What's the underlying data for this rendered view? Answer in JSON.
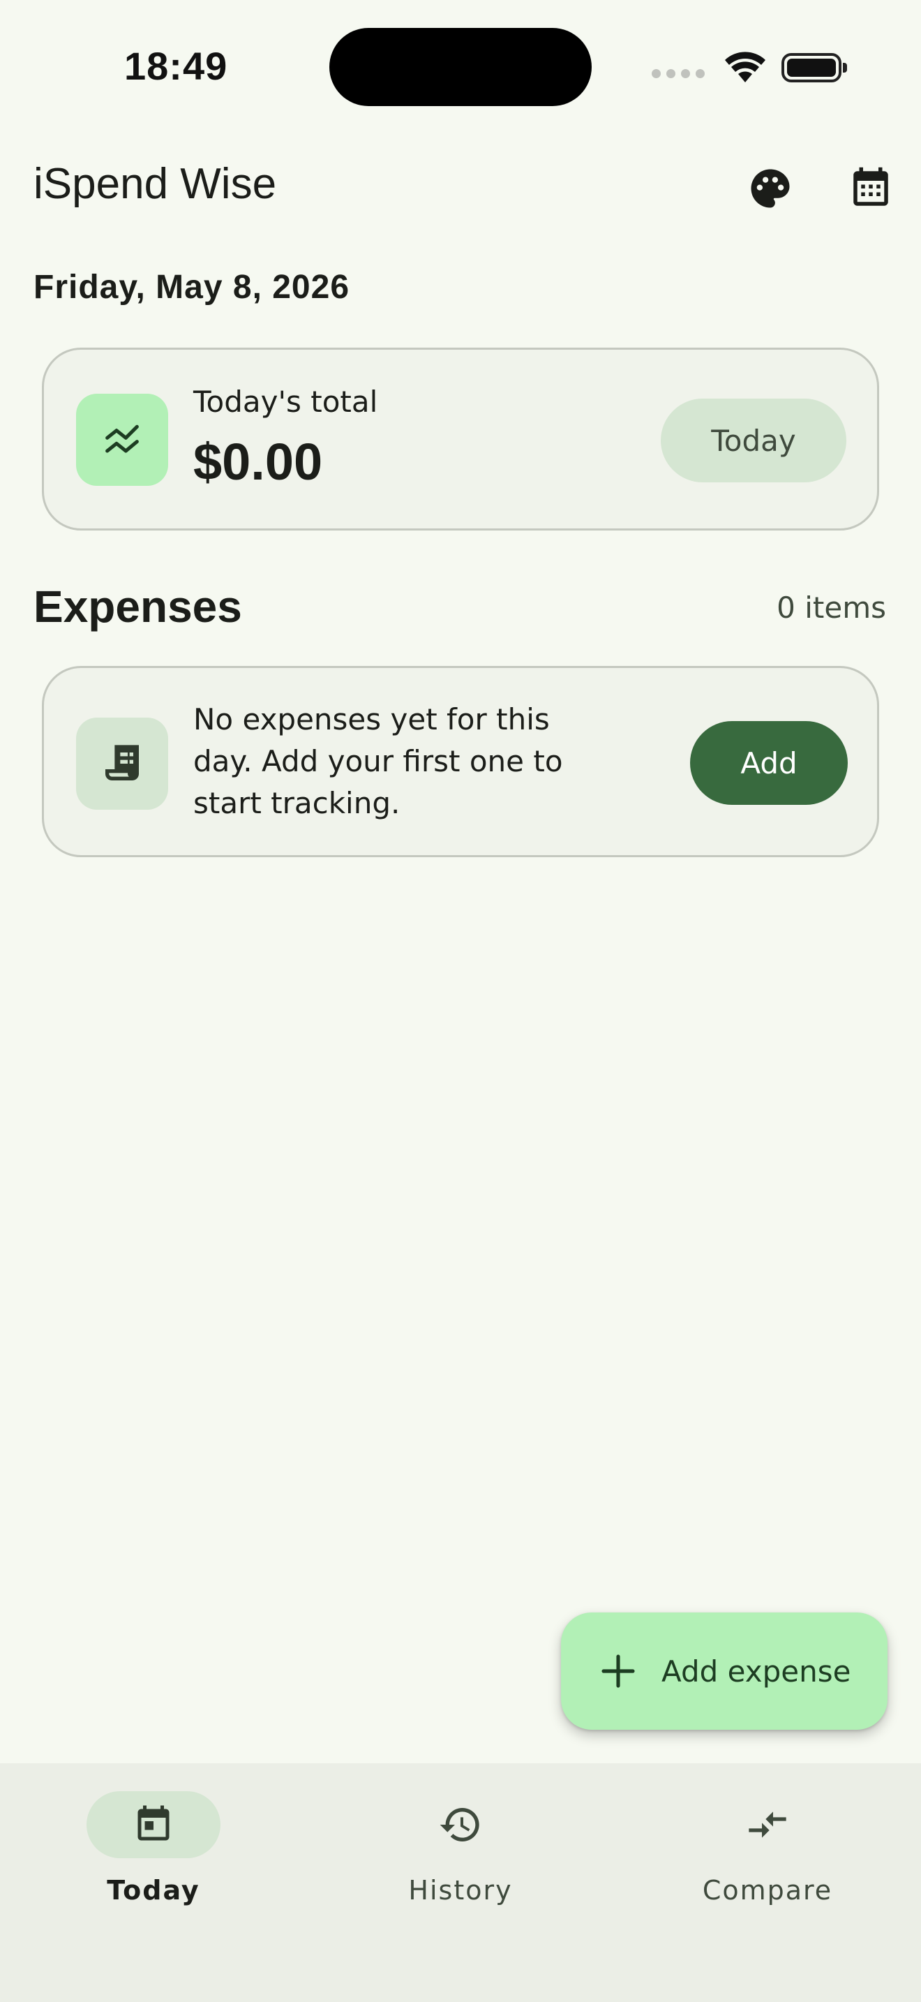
{
  "status_bar": {
    "time": "18:49",
    "icons": [
      "cellular-signal-icon",
      "wifi-icon",
      "battery-icon"
    ]
  },
  "app_bar": {
    "title": "iSpend Wise",
    "actions": [
      {
        "icon": "palette-icon"
      },
      {
        "icon": "calendar-icon"
      }
    ]
  },
  "date": "Friday, May 8, 2026",
  "summary": {
    "icon": "trend-icon",
    "label": "Today's total",
    "amount": "$0.00",
    "chip_label": "Today"
  },
  "expenses": {
    "title": "Expenses",
    "count": "0 items",
    "empty": {
      "icon": "receipt-icon",
      "message": "No expenses yet for this day. Add your first one to start tracking.",
      "button_label": "Add"
    }
  },
  "fab": {
    "icon": "plus-icon",
    "label": "Add expense"
  },
  "bottom_nav": {
    "items": [
      {
        "label": "Today",
        "icon": "calendar-today-icon",
        "selected": true
      },
      {
        "label": "History",
        "icon": "history-icon",
        "selected": false
      },
      {
        "label": "Compare",
        "icon": "compare-arrows-icon",
        "selected": false
      }
    ]
  },
  "colors": {
    "background": "#f6f9f1",
    "card": "#f0f3eb",
    "accent_light": "#b2f0b6",
    "accent_dark": "#386a3e",
    "chip": "#d5e6d2",
    "nav_background": "#ebeee6"
  }
}
